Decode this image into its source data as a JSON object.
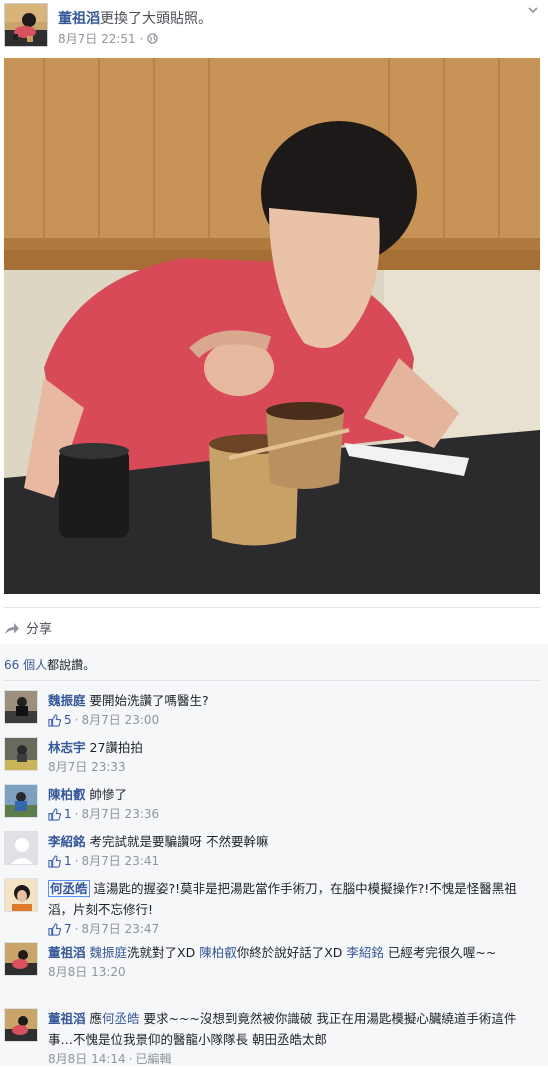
{
  "post": {
    "author": "董祖滔",
    "action": "更換了大頭貼照。",
    "timestamp": "8月7日 22:51",
    "separator": "·"
  },
  "share_label": "分享",
  "likes": {
    "count": "66 個人",
    "suffix": "都說讚。"
  },
  "comments": [
    {
      "name": "魏振庭",
      "text": " 要開始洗讚了嗎醫生?",
      "like_count": "5",
      "time": "8月7日 23:00"
    },
    {
      "name": "林志宇",
      "text": " 27讚拍拍",
      "like_count": "",
      "time": "8月7日 23:33"
    },
    {
      "name": "陳柏叡",
      "text": " 帥慘了",
      "like_count": "1",
      "time": "8月7日 23:36"
    },
    {
      "name": "李紹銘",
      "text": " 考完試就是要騙讚呀 不然要幹嘛",
      "like_count": "1",
      "time": "8月7日 23:41"
    },
    {
      "name": "何丞皓",
      "text": " 這湯匙的握姿?!莫非是把湯匙當作手術刀，在腦中模擬操作?!不愧是怪醫黑祖滔，片刻不忘修行!",
      "like_count": "7",
      "time": "8月7日 23:47"
    },
    {
      "name": "董祖滔",
      "m1": "魏振庭",
      "t1": "洗就對了XD ",
      "m2": "陳柏叡",
      "t2": "你終於說好話了XD ",
      "m3": "李紹銘",
      "t3": " 已經考完很久喔~~",
      "like_count": "",
      "time": "8月8日 13:20"
    },
    {
      "name": "董祖滔",
      "t0": " 應",
      "m1": "何丞皓",
      "t1": " 要求~~~沒想到竟然被你識破 我正在用湯匙模擬心臟繞道手術這件事…不愧是位我景仰的醫龍小隊隊長 朝田丞皓太郎",
      "like_count": "",
      "time": "8月8日 14:14",
      "edited": "已編輯"
    }
  ],
  "icons": {
    "share": "share-arrow-icon",
    "like": "thumbs-up-icon",
    "globe": "globe-icon",
    "menu": "chevron-down-icon"
  },
  "colors": {
    "link": "#365899",
    "meta": "#90949c",
    "ufi_bg": "#f6f7f9"
  }
}
